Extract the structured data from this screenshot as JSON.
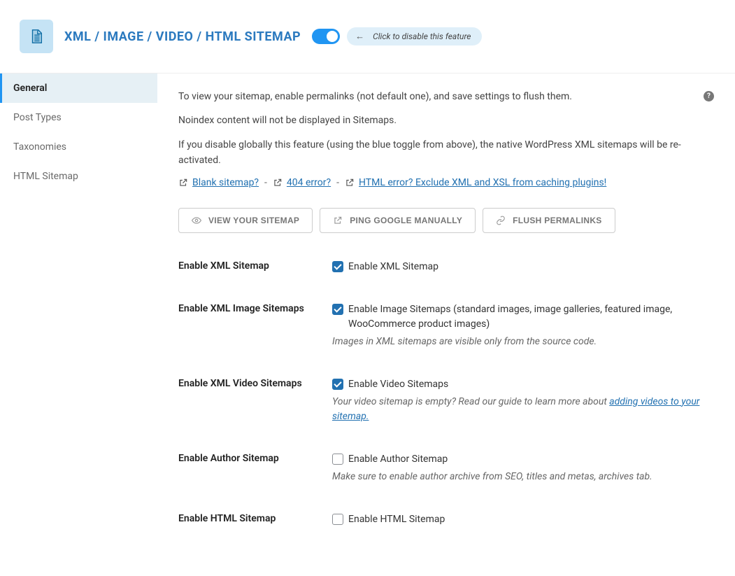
{
  "header": {
    "title": "XML / IMAGE / VIDEO / HTML SITEMAP",
    "toggle_hint": "Click to disable this feature"
  },
  "sidebar": {
    "items": [
      {
        "label": "General",
        "active": true
      },
      {
        "label": "Post Types",
        "active": false
      },
      {
        "label": "Taxonomies",
        "active": false
      },
      {
        "label": "HTML Sitemap",
        "active": false
      }
    ]
  },
  "intro": {
    "line1": "To view your sitemap, enable permalinks (not default one), and save settings to flush them.",
    "line2": "Noindex content will not be displayed in Sitemaps.",
    "line3": "If you disable globally this feature (using the blue toggle from above), the native WordPress XML sitemaps will be re-activated."
  },
  "help_links": {
    "link1": "Blank sitemap?",
    "link2": "404 error?",
    "link3": "HTML error? Exclude XML and XSL from caching plugins!",
    "sep": "-"
  },
  "buttons": {
    "view": "VIEW YOUR SITEMAP",
    "ping": "PING GOOGLE MANUALLY",
    "flush": "FLUSH PERMALINKS"
  },
  "fields": {
    "xml": {
      "title": "Enable XML Sitemap",
      "label": "Enable XML Sitemap"
    },
    "image": {
      "title": "Enable XML Image Sitemaps",
      "label": "Enable Image Sitemaps (standard images, image galleries, featured image, WooCommerce product images)",
      "help": "Images in XML sitemaps are visible only from the source code."
    },
    "video": {
      "title": "Enable XML Video Sitemaps",
      "label": "Enable Video Sitemaps",
      "help_prefix": "Your video sitemap is empty? Read our guide to learn more about ",
      "help_link": "adding videos to your sitemap."
    },
    "author": {
      "title": "Enable Author Sitemap",
      "label": "Enable Author Sitemap",
      "help": "Make sure to enable author archive from SEO, titles and metas, archives tab."
    },
    "html": {
      "title": "Enable HTML Sitemap",
      "label": "Enable HTML Sitemap"
    }
  }
}
